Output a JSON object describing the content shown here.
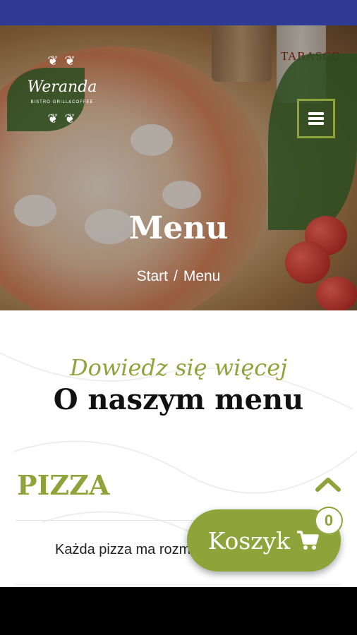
{
  "colors": {
    "status_bar": "#2e3a94",
    "accent": "#8ea43a",
    "heading": "#111111",
    "nav_bar": "#000000"
  },
  "hero": {
    "logo": {
      "brand": "Weranda",
      "tagline": "BISTRO·GRILL&COFFEE",
      "leaf_icon": "laurel-icon"
    },
    "menu_icon": "hamburger-menu-icon",
    "title": "Menu",
    "breadcrumb": {
      "home": "Start",
      "separator": "/",
      "current": "Menu"
    },
    "bottle_label": "TABASCO"
  },
  "intro": {
    "eyebrow": "Dowiedz się więcej",
    "title": "O naszym menu"
  },
  "accordion": {
    "title": "PIZZA",
    "expanded": true,
    "toggle_icon": "chevron-up-icon",
    "text": "Każda pizza ma rozm"
  },
  "cart": {
    "label": "Koszyk",
    "icon": "shopping-cart-icon",
    "count": "0"
  }
}
